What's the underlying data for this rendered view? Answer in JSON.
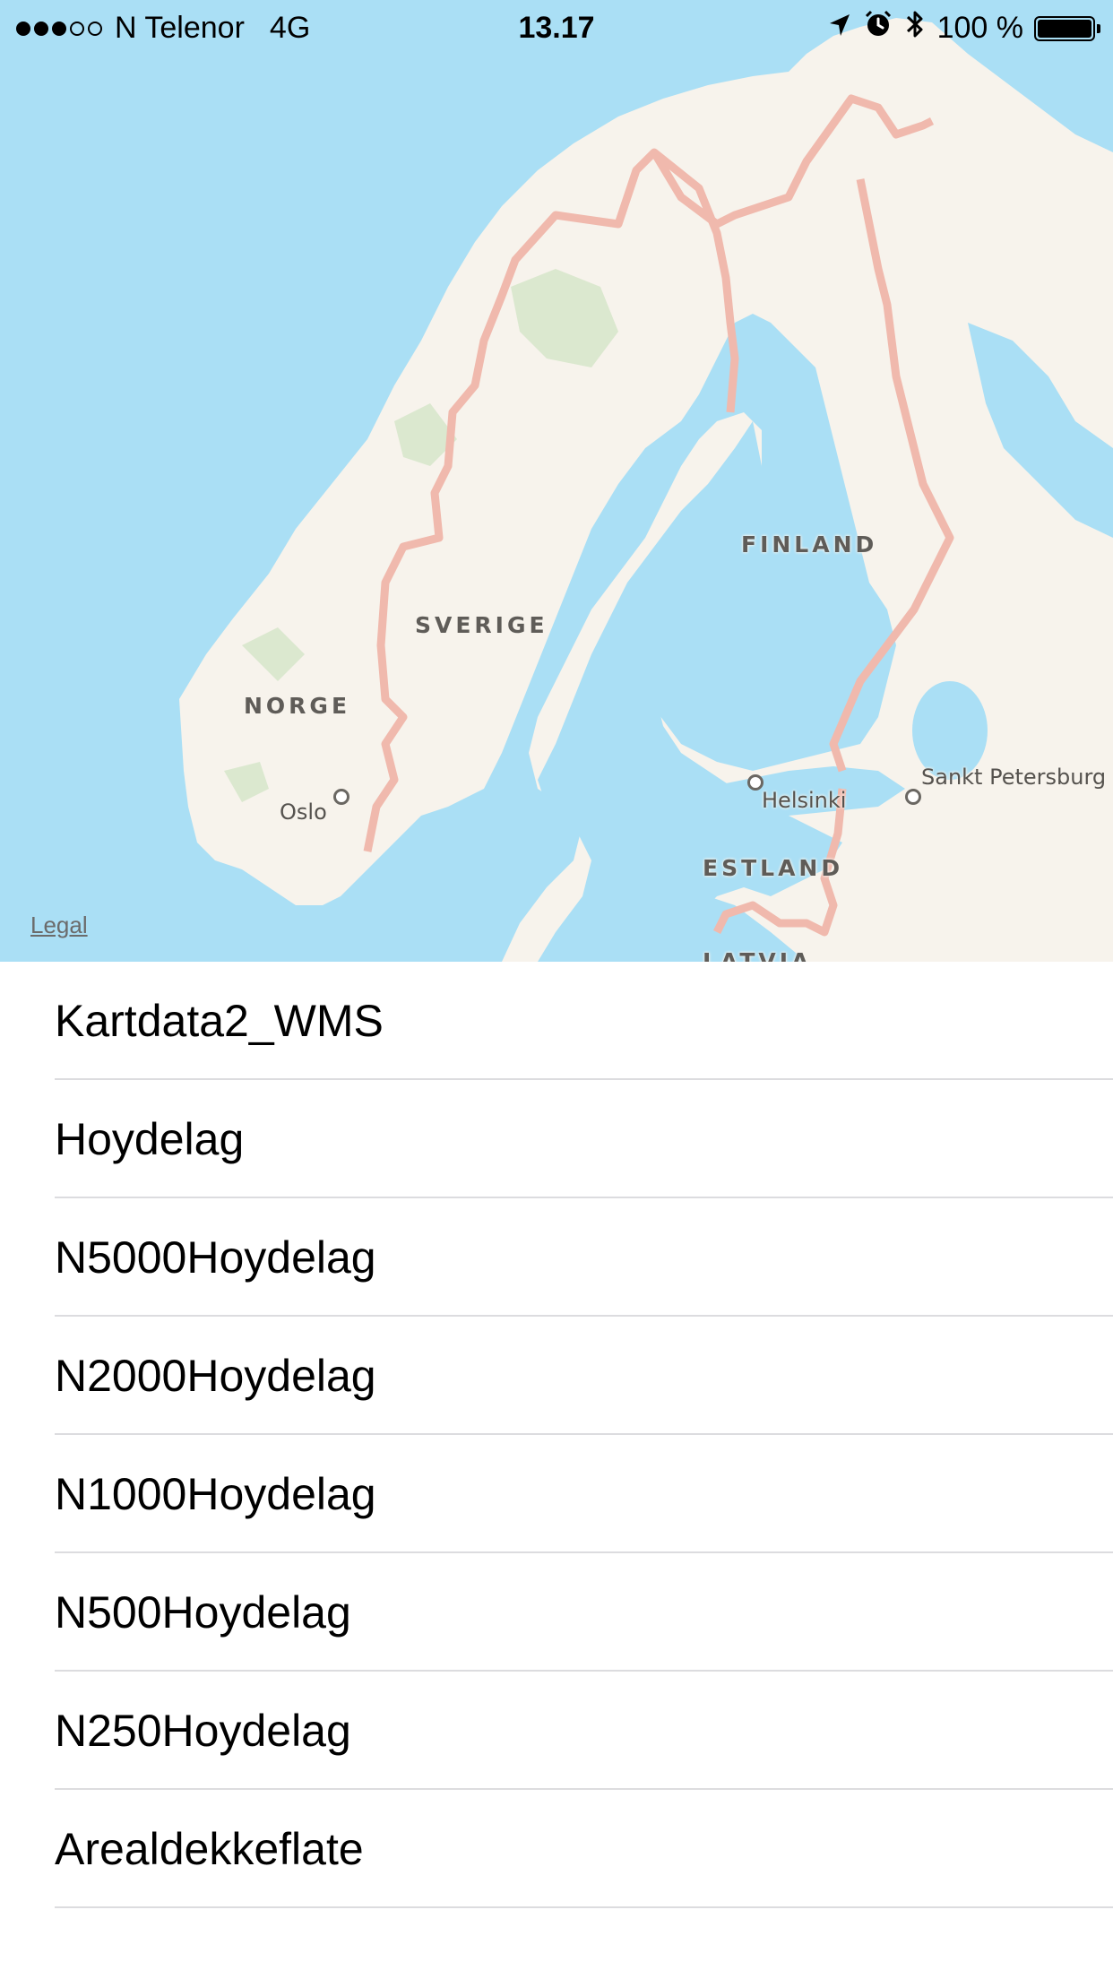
{
  "status_bar": {
    "signal_filled": 3,
    "signal_total": 5,
    "carrier": "N Telenor",
    "network": "4G",
    "time": "13.17",
    "battery_text": "100 %",
    "battery_level": 1.0,
    "icons": [
      "location-arrow-icon",
      "alarm-icon",
      "bluetooth-icon",
      "battery-icon"
    ]
  },
  "map": {
    "countries": {
      "norge": "NORGE",
      "sverige": "SVERIGE",
      "finland": "FINLAND",
      "estland": "ESTLAND",
      "latvia": "LATVIA"
    },
    "cities": {
      "oslo": "Oslo",
      "helsinki": "Helsinki",
      "sankt_petersburg": "Sankt Petersburg"
    },
    "legal": "Legal",
    "colors": {
      "water": "#aadff5",
      "land": "#f7f3ec",
      "border": "#f0b9ad",
      "forest": "#dbe8cf"
    }
  },
  "layers": [
    {
      "label": "Kartdata2_WMS"
    },
    {
      "label": "Hoydelag"
    },
    {
      "label": "N5000Hoydelag"
    },
    {
      "label": "N2000Hoydelag"
    },
    {
      "label": "N1000Hoydelag"
    },
    {
      "label": "N500Hoydelag"
    },
    {
      "label": "N250Hoydelag"
    },
    {
      "label": "Arealdekkeflate"
    }
  ]
}
